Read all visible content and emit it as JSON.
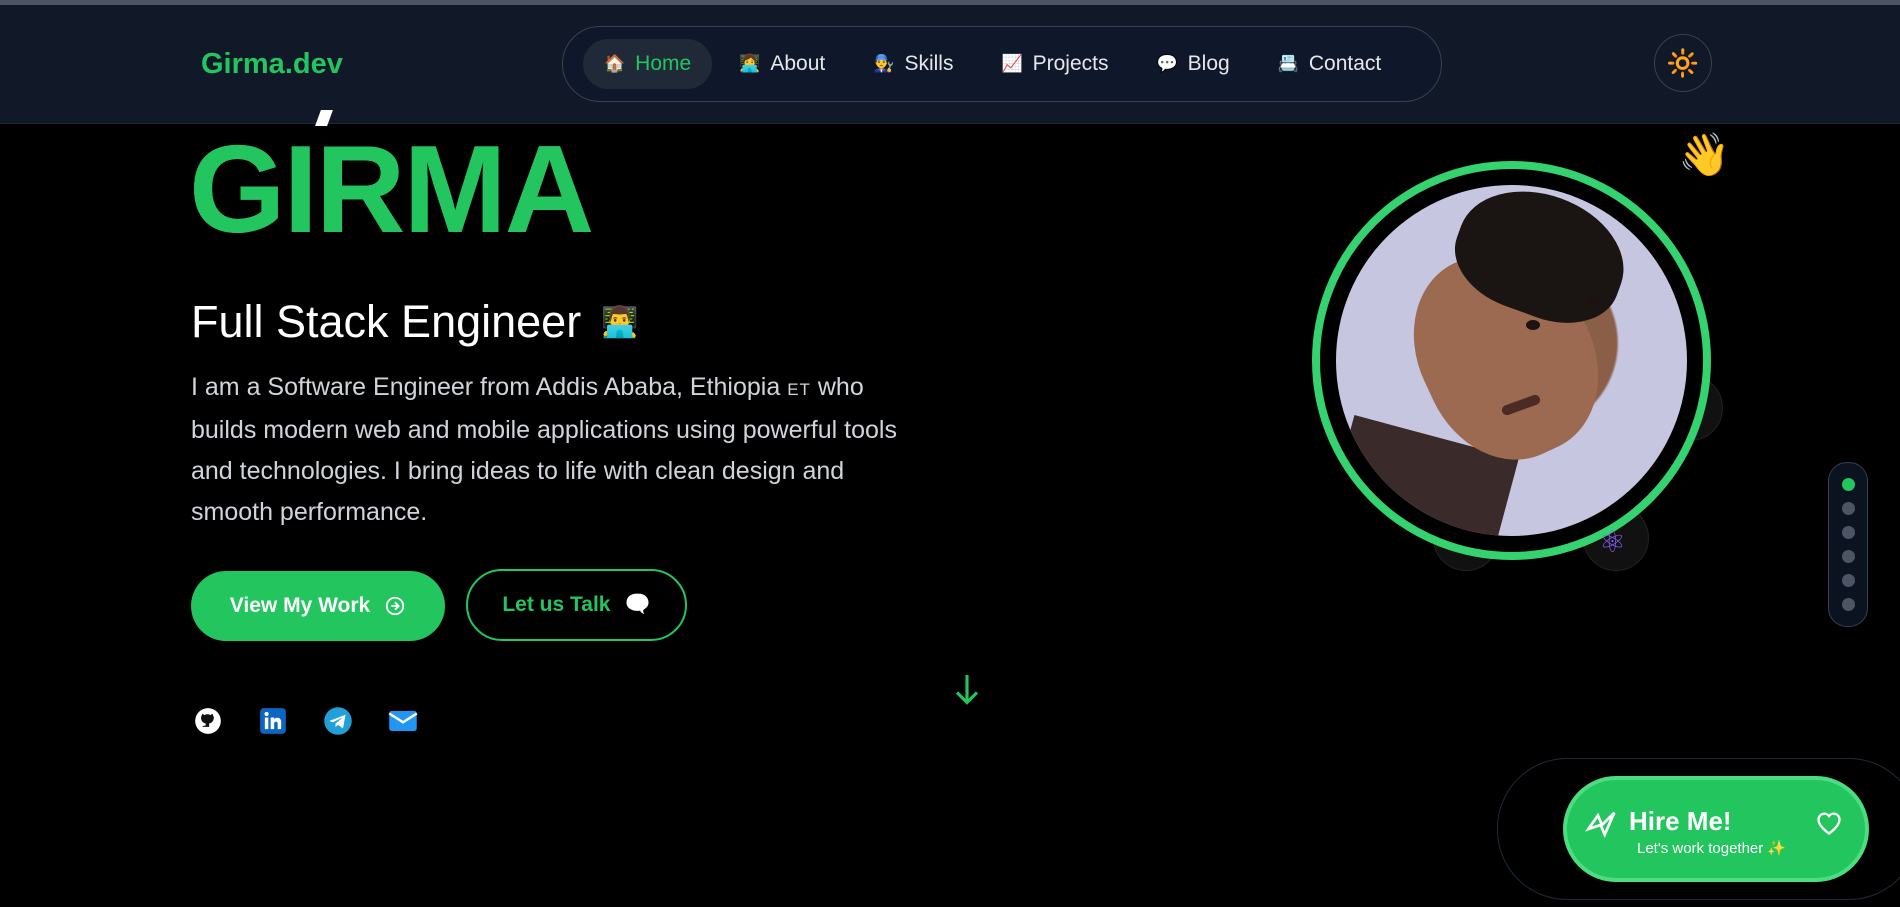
{
  "brand": "Girma.dev",
  "nav": [
    {
      "icon": "🏠",
      "label": "Home",
      "active": true
    },
    {
      "icon": "👩‍💻",
      "label": "About"
    },
    {
      "icon": "👨‍🔧",
      "label": "Skills"
    },
    {
      "icon": "📈",
      "label": "Projects"
    },
    {
      "icon": "💬",
      "label": "Blog"
    },
    {
      "icon": "📇",
      "label": "Contact"
    }
  ],
  "theme_icon": "🔆",
  "hero": {
    "name": "GIRMA",
    "role": "Full Stack Engineer",
    "role_icon": "👨‍💻",
    "bio_a": "I am a Software Engineer from Addis Ababa, Ethiopia",
    "bio_flag": "ET",
    "bio_b": " who builds modern web and mobile applications using powerful tools and technologies. I bring ideas to life with clean design and smooth performance.",
    "primary_cta": "View My Work",
    "secondary_cta": "Let us Talk",
    "secondary_icon": "🗨️",
    "wave": "👋"
  },
  "social": [
    "github-icon",
    "linkedin-icon",
    "telegram-icon",
    "mail-icon"
  ],
  "section_dots": 6,
  "hire": {
    "title": "Hire Me!",
    "subtitle": "Let's work together ✨"
  },
  "colors": {
    "accent": "#22c55e",
    "bg": "#000000",
    "nav": "#111827"
  }
}
